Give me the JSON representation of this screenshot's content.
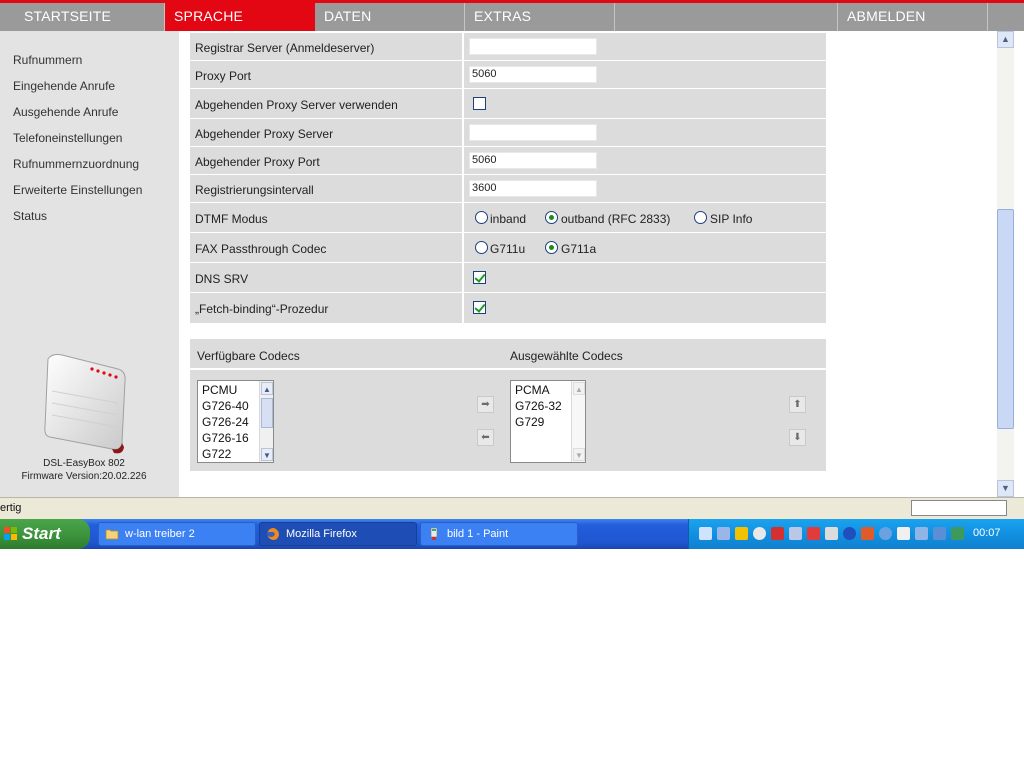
{
  "nav": {
    "items": [
      "STARTSEITE",
      "SPRACHE",
      "DATEN",
      "EXTRAS",
      "",
      "ABMELDEN"
    ],
    "active": "SPRACHE",
    "accent_color": "#e30613"
  },
  "sidebar": {
    "links": [
      "Rufnummern",
      "Eingehende Anrufe",
      "Ausgehende Anrufe",
      "Telefoneinstellungen",
      "Rufnummernzuordnung",
      "Erweiterte Einstellungen",
      "Status"
    ],
    "device_name": "DSL-EasyBox 802",
    "firmware": "Firmware Version:20.02.226"
  },
  "settings": {
    "registrar_server": {
      "label": "Registrar Server (Anmeldeserver)",
      "value": ""
    },
    "proxy_port": {
      "label": "Proxy Port",
      "value": "5060"
    },
    "use_outbound_proxy": {
      "label": "Abgehenden Proxy Server verwenden",
      "checked": false
    },
    "outbound_proxy_server": {
      "label": "Abgehender Proxy Server",
      "value": ""
    },
    "outbound_proxy_port": {
      "label": "Abgehender Proxy Port",
      "value": "5060"
    },
    "registration_interval": {
      "label": "Registrierungsintervall",
      "value": "3600"
    },
    "dtmf_mode": {
      "label": "DTMF Modus",
      "options": [
        "inband",
        "outband (RFC 2833)",
        "SIP Info"
      ],
      "selected": "outband (RFC 2833)"
    },
    "fax_codec": {
      "label": "FAX Passthrough Codec",
      "options": [
        "G711u",
        "G711a"
      ],
      "selected": "G711a"
    },
    "dns_srv": {
      "label": "DNS SRV",
      "checked": true
    },
    "fetch_binding": {
      "label": "„Fetch-binding“-Prozedur",
      "checked": true
    }
  },
  "codecs": {
    "available_label": "Verfügbare Codecs",
    "selected_label": "Ausgewählte Codecs",
    "available": [
      "PCMU",
      "G726-40",
      "G726-24",
      "G726-16",
      "G722"
    ],
    "selected": [
      "PCMA",
      "G726-32",
      "G729"
    ]
  },
  "statusbar": {
    "text": "ertig"
  },
  "taskbar": {
    "start_label": "Start",
    "tasks": [
      {
        "label": "w-lan treiber 2",
        "icon": "folder-icon"
      },
      {
        "label": "Mozilla Firefox",
        "icon": "firefox-icon"
      },
      {
        "label": "bild 1 - Paint",
        "icon": "paint-icon"
      }
    ],
    "active_task": "Mozilla Firefox",
    "clock": "00:07"
  }
}
